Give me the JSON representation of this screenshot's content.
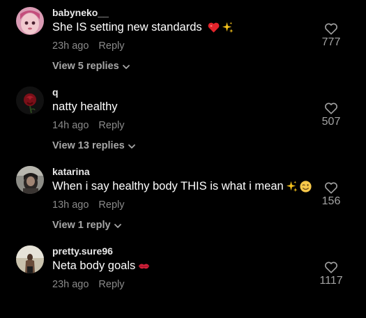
{
  "colors": {
    "background": "#000000",
    "username": "#e8e8e8",
    "text": "#ffffff",
    "meta": "#8a8a8a",
    "view_replies": "#a7a7a7",
    "like_count": "#a3a3a3"
  },
  "comments": [
    {
      "username": "babyneko__",
      "text": "She IS setting new standards",
      "emojis": [
        "red-heart",
        "sparkles"
      ],
      "time": "23h ago",
      "reply_label": "Reply",
      "replies_label": "View 5 replies",
      "likes": "777"
    },
    {
      "username": "q",
      "text": "natty healthy",
      "emojis": [],
      "time": "14h ago",
      "reply_label": "Reply",
      "replies_label": "View 13 replies",
      "likes": "507"
    },
    {
      "username": "katarina",
      "text": "When i say healthy body THIS is what i mean",
      "emojis": [
        "sparkles",
        "winking-face"
      ],
      "time": "13h ago",
      "reply_label": "Reply",
      "replies_label": "View 1 reply",
      "likes": "156"
    },
    {
      "username": "pretty.sure96",
      "text": "Neta body goals",
      "emojis": [
        "kiss-mark"
      ],
      "time": "23h ago",
      "reply_label": "Reply",
      "replies_label": "",
      "likes": "1117"
    }
  ]
}
